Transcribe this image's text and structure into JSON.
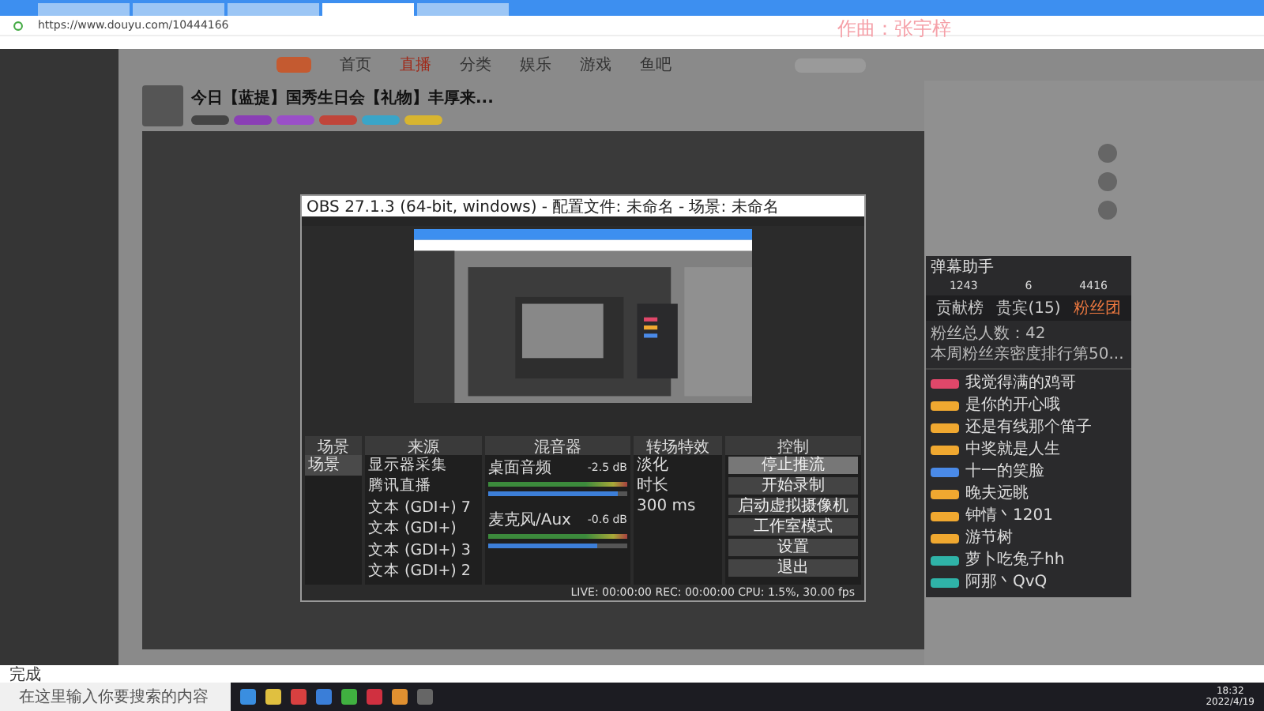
{
  "browser": {
    "tabs": [
      {
        "selected": false
      },
      {
        "selected": false
      },
      {
        "selected": false
      },
      {
        "selected": true
      },
      {
        "selected": false
      }
    ],
    "address": "https://www.douyu.com/10444166"
  },
  "overlay_caption": "作曲：张宇梓",
  "site": {
    "nav": [
      {
        "label": "首页",
        "selected": false
      },
      {
        "label": "直播",
        "selected": true
      },
      {
        "label": "分类",
        "selected": false
      },
      {
        "label": "娱乐",
        "selected": false
      },
      {
        "label": "游戏",
        "selected": false
      },
      {
        "label": "鱼吧",
        "selected": false
      }
    ],
    "room": {
      "title": "今日【蓝提】国秀生日会【礼物】丰厚来...",
      "tags": [
        {
          "color": "#444444"
        },
        {
          "color": "#8a3fb5"
        },
        {
          "color": "#9a4fc8"
        },
        {
          "color": "#c0453a"
        },
        {
          "color": "#3aa5c8"
        },
        {
          "color": "#d8b530"
        }
      ]
    }
  },
  "obs": {
    "title": "OBS 27.1.3 (64-bit, windows) - 配置文件: 未命名 - 场景: 未命名",
    "docks": [
      "场景",
      "来源",
      "混音器",
      "转场特效",
      "控制"
    ],
    "scenes": [
      {
        "name": "场景",
        "selected": true
      }
    ],
    "sources": [
      "显示器采集",
      "腾讯直播",
      "文本 (GDI+) 7",
      "文本 (GDI+)",
      "文本 (GDI+) 3",
      "文本 (GDI+) 2"
    ],
    "mixer": [
      {
        "name": "桌面音频",
        "reading": "-2.5 dB",
        "level": 0.93
      },
      {
        "name": "麦克风/Aux",
        "reading": "-0.6 dB",
        "level": 0.78
      }
    ],
    "transition": "淡化",
    "duration_label": "时长",
    "duration": "300 ms",
    "controls": [
      {
        "label": "停止推流",
        "selected": true
      },
      {
        "label": "开始录制",
        "selected": false
      },
      {
        "label": "启动虚拟摄像机",
        "selected": false
      },
      {
        "label": "工作室模式",
        "selected": false
      },
      {
        "label": "设置",
        "selected": false
      },
      {
        "label": "退出",
        "selected": false
      }
    ],
    "status": "LIVE: 00:00:00  REC: 00:00:00  CPU: 1.5%, 30.00 fps"
  },
  "fan_panel": {
    "title": "弹幕助手",
    "stats": [
      "1243",
      "6",
      "4416"
    ],
    "tabs": [
      {
        "label": "贡献榜",
        "selected": false
      },
      {
        "label": "贵宾(15)",
        "selected": false
      },
      {
        "label": "粉丝团",
        "selected": true
      }
    ],
    "total": "粉丝总人数：42",
    "rank": "本周粉丝亲密度排行第50...",
    "fans": [
      {
        "name": "我觉得满的鸡哥",
        "color": "#e0476a"
      },
      {
        "name": "是你的开心哦",
        "color": "#f0a830"
      },
      {
        "name": "还是有线那个笛子",
        "color": "#f0a830"
      },
      {
        "name": "中奖就是人生",
        "color": "#f0a830"
      },
      {
        "name": "十一的笑脸",
        "color": "#4a8ae8"
      },
      {
        "name": "晚夫远眺",
        "color": "#f0a830"
      },
      {
        "name": "钟情丶1201",
        "color": "#f0a830"
      },
      {
        "name": "游节树",
        "color": "#f0a830"
      },
      {
        "name": "萝卜吃兔子hh",
        "color": "#2fb3a8"
      },
      {
        "name": "阿那丶QvQ",
        "color": "#2fb3a8"
      }
    ]
  },
  "status_bar": "完成",
  "taskbar": {
    "search_placeholder": "在这里输入你要搜索的内容",
    "time": "18:32",
    "date": "2022/4/19"
  }
}
